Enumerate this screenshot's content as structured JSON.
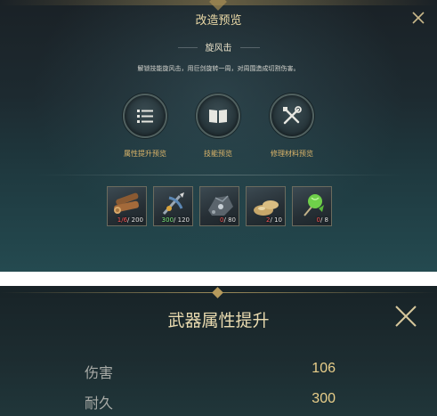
{
  "popup": {
    "title": "改造预览",
    "skill_name": "旋风击",
    "skill_description": "解锁技能旋风击，用巨剑旋转一周，对周围造成切割伤害。",
    "features": [
      {
        "icon": "list-icon",
        "label": "属性提升预览"
      },
      {
        "icon": "book-icon",
        "label": "技能预览"
      },
      {
        "icon": "tools-icon",
        "label": "修理材料预览"
      }
    ],
    "materials": [
      {
        "icon": "wood-logs-icon",
        "have": "1/6",
        "need": "/ 200",
        "enough": false
      },
      {
        "icon": "crossbow-icon",
        "have": "300",
        "need": "/ 120",
        "enough": true
      },
      {
        "icon": "ore-icon",
        "have": "0",
        "need": "/ 80",
        "enough": false
      },
      {
        "icon": "stones-icon",
        "have": "2",
        "need": "/ 10",
        "enough": false
      },
      {
        "icon": "herb-icon",
        "have": "0",
        "need": "/ 8",
        "enough": false
      }
    ]
  },
  "attributes": {
    "title": "武器属性提升",
    "stats": [
      {
        "name": "伤害",
        "value": "106"
      },
      {
        "name": "耐久",
        "value": "300"
      }
    ]
  },
  "colors": {
    "gold_text": "#ddb66a",
    "insufficient": "#ff5555",
    "sufficient": "#7ef07e"
  }
}
